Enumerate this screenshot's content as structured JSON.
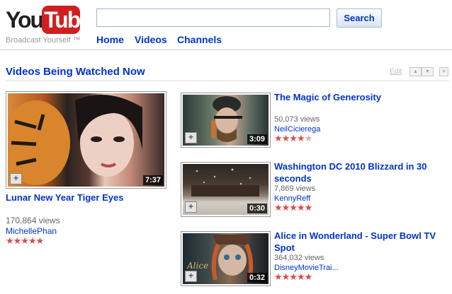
{
  "header": {
    "logo_you": "You",
    "logo_tube": "Tube",
    "tagline": "Broadcast Yourself ™",
    "search": {
      "value": "",
      "button": "Search"
    },
    "nav": [
      "Home",
      "Videos",
      "Channels"
    ]
  },
  "section": {
    "title": "Videos Being Watched Now",
    "edit": "Edit",
    "controls": [
      "move-up",
      "move-down",
      "close"
    ]
  },
  "featured": {
    "title": "Lunar New Year Tiger Eyes",
    "views": "170,864 views",
    "author": "MichellePhan",
    "duration": "7:37",
    "rating": 5
  },
  "videos": [
    {
      "title": "The Magic of Generosity",
      "views": "50,073 views",
      "author": "NeilCicierega",
      "duration": "3:09",
      "rating": 4.5
    },
    {
      "title": "Washington DC 2010 Blizzard in 30 seconds",
      "views": "7,869 views",
      "author": "KennyReff",
      "duration": "0:30",
      "rating": 5
    },
    {
      "title": "Alice in Wonderland - Super Bowl TV Spot",
      "views": "364,032 views",
      "author": "DisneyMovieTrai...",
      "duration": "0:32",
      "rating": 5
    }
  ],
  "colors": {
    "link": "#0033cc",
    "brand_red": "#cf1f1f",
    "star": "#d94c4c"
  }
}
